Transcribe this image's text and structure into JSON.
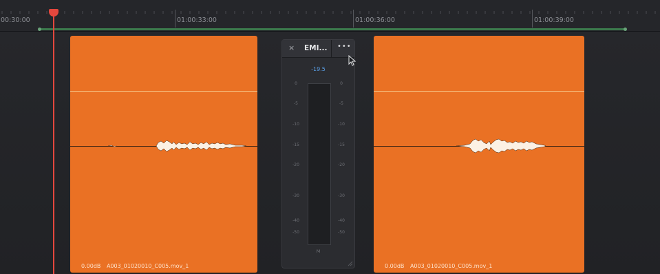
{
  "timeline": {
    "timecodes": [
      "00:30:00",
      "01:00:33:00",
      "01:00:36:00",
      "01:00:39:00"
    ]
  },
  "clips": [
    {
      "gain_label": "0.00dB",
      "name": "A003_01020010_C005.mov_1"
    },
    {
      "gain_label": "0.00dB",
      "name": "A003_01020010_C005.mov_1"
    }
  ],
  "meter": {
    "close_glyph": "×",
    "title": "EMI...",
    "more_glyph": "•••",
    "peak": "-19.5",
    "scale": [
      "0",
      "-5",
      "-10",
      "-15",
      "-20",
      "-30",
      "-40",
      "-50"
    ],
    "channel_label": "M",
    "level_db": null
  },
  "colors": {
    "clip": "#ea7124",
    "playhead": "#e4473d",
    "range_bar": "#3b7a4c",
    "peak_text": "#5aa0e8"
  },
  "icons": {
    "playhead": "playhead-marker-icon",
    "close": "close-icon",
    "more": "more-options-icon",
    "cursor": "mouse-pointer-icon"
  }
}
